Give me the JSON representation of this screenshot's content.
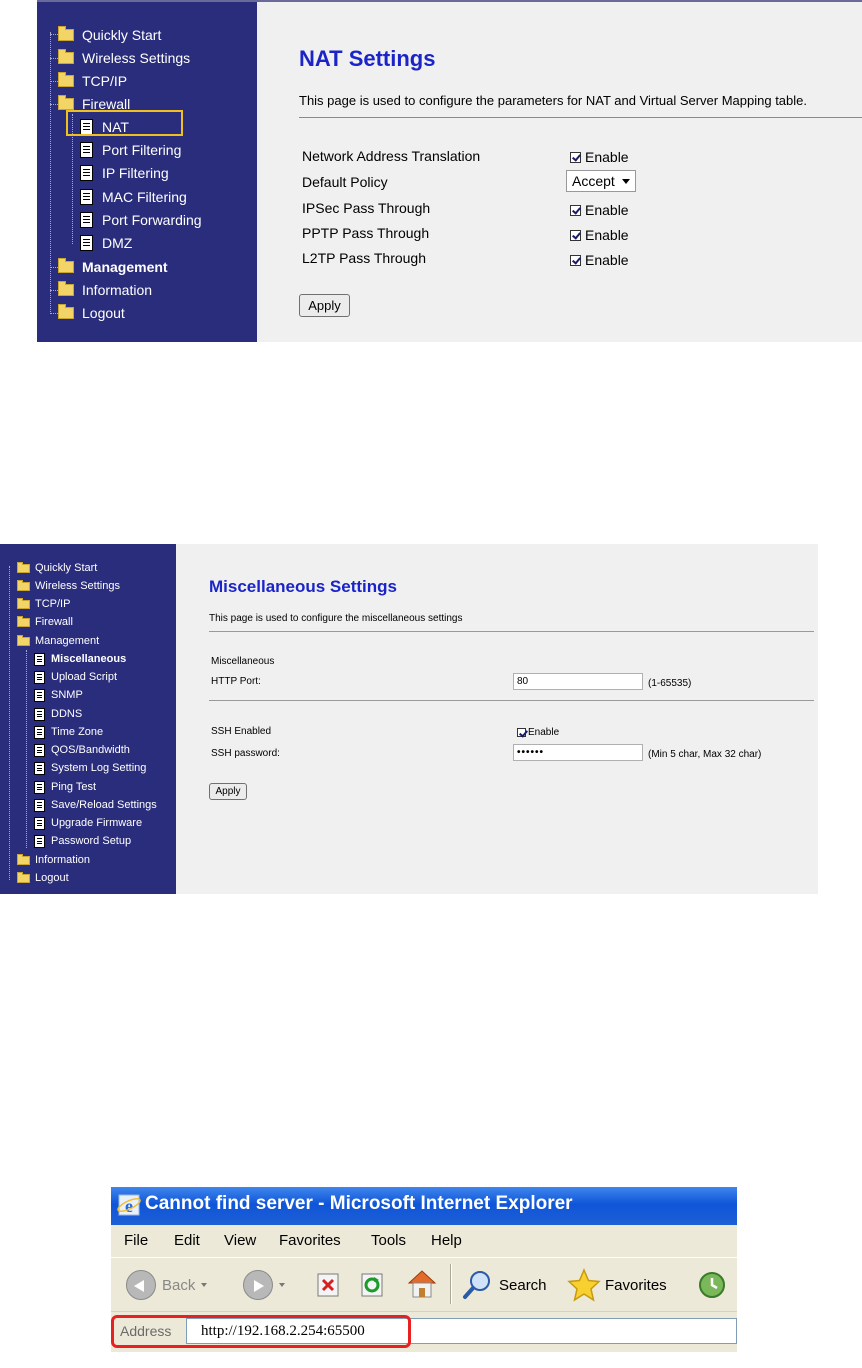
{
  "panel1": {
    "nav": {
      "items": [
        {
          "label": "Quickly Start",
          "icon": "folder-icon"
        },
        {
          "label": "Wireless Settings",
          "icon": "folder-icon"
        },
        {
          "label": "TCP/IP",
          "icon": "folder-icon"
        },
        {
          "label": "Firewall",
          "icon": "folder-open-icon"
        },
        {
          "label": "NAT",
          "icon": "page-icon"
        },
        {
          "label": "Port Filtering",
          "icon": "page-icon"
        },
        {
          "label": "IP Filtering",
          "icon": "page-icon"
        },
        {
          "label": "MAC Filtering",
          "icon": "page-icon"
        },
        {
          "label": "Port Forwarding",
          "icon": "page-icon"
        },
        {
          "label": "DMZ",
          "icon": "page-icon"
        },
        {
          "label": "Management",
          "icon": "folder-icon"
        },
        {
          "label": "Information",
          "icon": "folder-icon"
        },
        {
          "label": "Logout",
          "icon": "folder-icon"
        }
      ]
    },
    "title": "NAT Settings",
    "description": "This page is used to configure the parameters for NAT and Virtual Server Mapping table.",
    "rows": [
      {
        "label": "Network Address Translation",
        "control": "checkbox",
        "checked": true,
        "text": "Enable"
      },
      {
        "label": "Default Policy",
        "control": "select",
        "value": "Accept"
      },
      {
        "label": "IPSec Pass Through",
        "control": "checkbox",
        "checked": true,
        "text": "Enable"
      },
      {
        "label": "PPTP Pass Through",
        "control": "checkbox",
        "checked": true,
        "text": "Enable"
      },
      {
        "label": "L2TP Pass Through",
        "control": "checkbox",
        "checked": true,
        "text": "Enable"
      }
    ],
    "apply_label": "Apply",
    "colors": {
      "nav_bg": "#2a2d7c",
      "title": "#1a24c8",
      "highlight": "#f0c020",
      "content_bg": "#f0f0f0"
    }
  },
  "panel2": {
    "nav": {
      "items": [
        {
          "label": "Quickly Start",
          "icon": "folder-icon"
        },
        {
          "label": "Wireless Settings",
          "icon": "folder-icon"
        },
        {
          "label": "TCP/IP",
          "icon": "folder-icon"
        },
        {
          "label": "Firewall",
          "icon": "folder-icon"
        },
        {
          "label": "Management",
          "icon": "folder-open-icon"
        },
        {
          "label": "Miscellaneous",
          "icon": "page-icon"
        },
        {
          "label": "Upload Script",
          "icon": "page-icon"
        },
        {
          "label": "SNMP",
          "icon": "page-icon"
        },
        {
          "label": "DDNS",
          "icon": "page-icon"
        },
        {
          "label": "Time Zone",
          "icon": "page-icon"
        },
        {
          "label": "QOS/Bandwidth",
          "icon": "page-icon"
        },
        {
          "label": "System Log Setting",
          "icon": "page-icon"
        },
        {
          "label": "Ping Test",
          "icon": "page-icon"
        },
        {
          "label": "Save/Reload Settings",
          "icon": "page-icon"
        },
        {
          "label": "Upgrade Firmware",
          "icon": "page-icon"
        },
        {
          "label": "Password Setup",
          "icon": "page-icon"
        },
        {
          "label": "Information",
          "icon": "folder-icon"
        },
        {
          "label": "Logout",
          "icon": "folder-icon"
        }
      ]
    },
    "title": "Miscellaneous Settings",
    "description": "This page is used to configure the miscellaneous settings",
    "section_label": "Miscellaneous",
    "http_port_label": "HTTP Port:",
    "http_port_value": "80",
    "http_port_hint": "(1-65535)",
    "ssh_enabled_label": "SSH Enabled",
    "ssh_enabled_checked": true,
    "ssh_enabled_text": "Enable",
    "ssh_password_label": "SSH password:",
    "ssh_password_value": "••••••",
    "ssh_password_hint": "(Min 5 char, Max 32 char)",
    "apply_label": "Apply"
  },
  "panel3": {
    "window_title": "Cannot find server - Microsoft Internet Explorer",
    "menu": [
      "File",
      "Edit",
      "View",
      "Favorites",
      "Tools",
      "Help"
    ],
    "toolbar": {
      "back_label": "Back",
      "search_label": "Search",
      "favorites_label": "Favorites"
    },
    "address_label": "Address",
    "address_value": "http://192.168.2.254:65500",
    "colors": {
      "titlebar": "#0f55d8",
      "chrome": "#ece9d8",
      "highlight": "#e82020"
    }
  }
}
